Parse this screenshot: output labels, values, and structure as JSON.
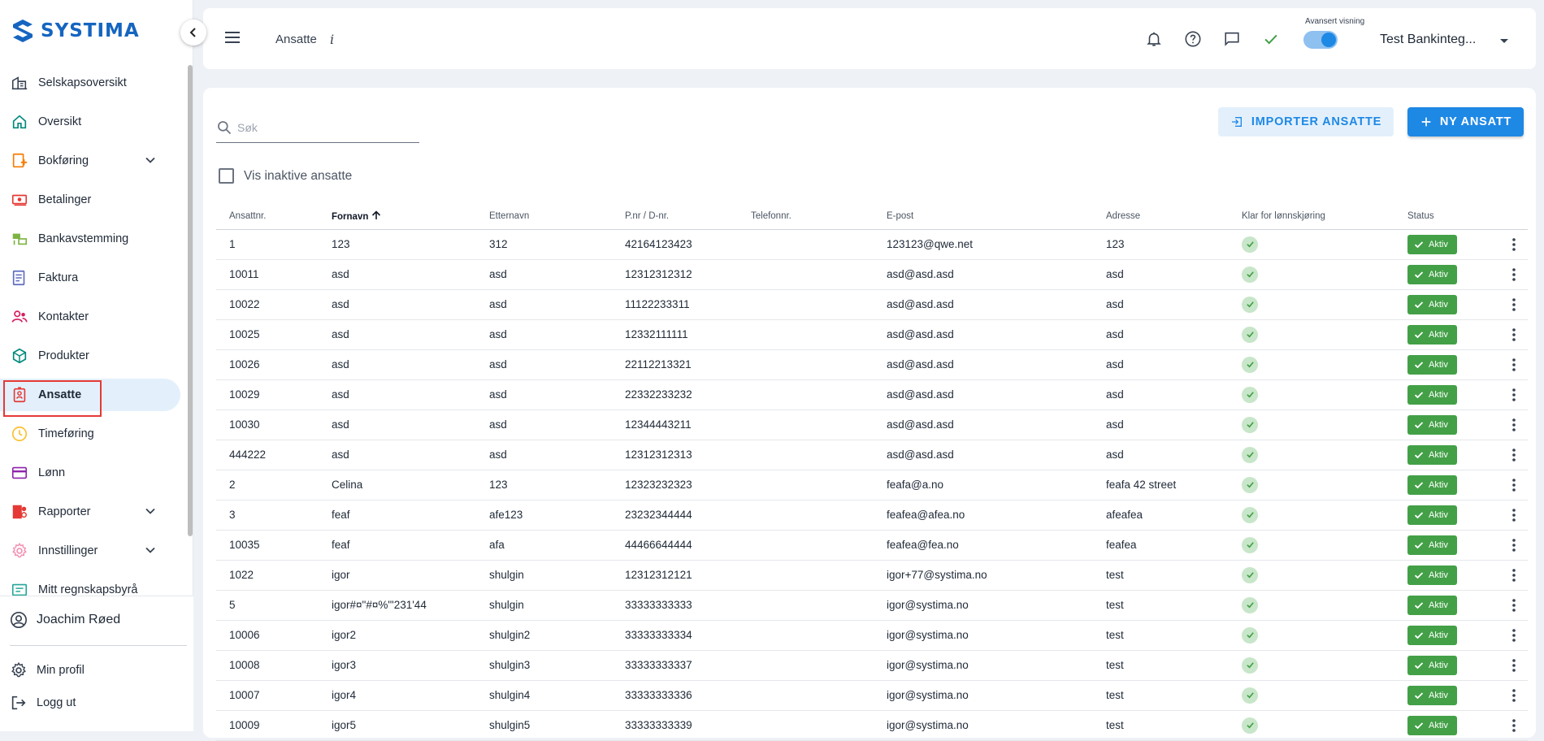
{
  "brand": {
    "name": "SYSTIMA",
    "color": "#1565c0"
  },
  "sidebar": {
    "items": [
      {
        "label": "Selskapsoversikt",
        "icon": "company-overview-icon",
        "color": "#374151"
      },
      {
        "label": "Oversikt",
        "icon": "home-icon",
        "color": "#00897b"
      },
      {
        "label": "Bokføring",
        "icon": "bookkeeping-icon",
        "color": "#f57c00",
        "expandable": true
      },
      {
        "label": "Betalinger",
        "icon": "payments-icon",
        "color": "#e53935"
      },
      {
        "label": "Bankavstemming",
        "icon": "bank-reconciliation-icon",
        "color": "#7cb342"
      },
      {
        "label": "Faktura",
        "icon": "invoice-icon",
        "color": "#5c6bc0"
      },
      {
        "label": "Kontakter",
        "icon": "contacts-icon",
        "color": "#d81b60"
      },
      {
        "label": "Produkter",
        "icon": "products-icon",
        "color": "#00897b"
      },
      {
        "label": "Ansatte",
        "icon": "employees-icon",
        "color": "#e53935",
        "active": true
      },
      {
        "label": "Timeføring",
        "icon": "clock-icon",
        "color": "#fbc02d"
      },
      {
        "label": "Lønn",
        "icon": "salary-icon",
        "color": "#8e24aa"
      },
      {
        "label": "Rapporter",
        "icon": "reports-icon",
        "color": "#e53935",
        "expandable": true
      },
      {
        "label": "Innstillinger",
        "icon": "settings-icon",
        "color": "#f48fb1",
        "expandable": true
      },
      {
        "label": "Mitt regnskapsbyrå",
        "icon": "accounting-firm-icon",
        "color": "#26a69a"
      }
    ],
    "user_name": "Joachim Røed",
    "profile_label": "Min profil",
    "logout_label": "Logg ut"
  },
  "topbar": {
    "title": "Ansatte",
    "info": "i",
    "advanced_view_label": "Avansert visning",
    "advanced_view_on": true,
    "company": "Test Bankinteg..."
  },
  "toolbar": {
    "search_placeholder": "Søk",
    "import_label": "IMPORTER ANSATTE",
    "new_label": "NY ANSATT",
    "inactive_label": "Vis inaktive ansatte"
  },
  "table": {
    "headers": [
      "Ansattnr.",
      "Fornavn",
      "Etternavn",
      "P.nr / D-nr.",
      "Telefonnr.",
      "E-post",
      "Adresse",
      "Klar for lønnskjøring",
      "Status"
    ],
    "sort_column": "Fornavn",
    "status_label": "Aktiv",
    "rows": [
      [
        "1",
        "123",
        "312",
        "42164123423",
        "",
        "123123@qwe.net",
        "123"
      ],
      [
        "10011",
        "asd",
        "asd",
        "12312312312",
        "",
        "asd@asd.asd",
        "asd"
      ],
      [
        "10022",
        "asd",
        "asd",
        "11122233311",
        "",
        "asd@asd.asd",
        "asd"
      ],
      [
        "10025",
        "asd",
        "asd",
        "12332111111",
        "",
        "asd@asd.asd",
        "asd"
      ],
      [
        "10026",
        "asd",
        "asd",
        "22112213321",
        "",
        "asd@asd.asd",
        "asd"
      ],
      [
        "10029",
        "asd",
        "asd",
        "22332233232",
        "",
        "asd@asd.asd",
        "asd"
      ],
      [
        "10030",
        "asd",
        "asd",
        "12344443211",
        "",
        "asd@asd.asd",
        "asd"
      ],
      [
        "444222",
        "asd",
        "asd",
        "12312312313",
        "",
        "asd@asd.asd",
        "asd"
      ],
      [
        "2",
        "Celina",
        "123",
        "12323232323",
        "",
        "feafa@a.no",
        "feafa 42 street"
      ],
      [
        "3",
        "feaf",
        "afe123",
        "23232344444",
        "",
        "feafea@afea.no",
        "afeafea"
      ],
      [
        "10035",
        "feaf",
        "afa",
        "44466644444",
        "",
        "feafea@fea.no",
        "feafea"
      ],
      [
        "1022",
        "igor",
        "shulgin",
        "12312312121",
        "",
        "igor+77@systima.no",
        "test"
      ],
      [
        "5",
        "igor#¤\"#¤%\"'231'44",
        "shulgin",
        "33333333333",
        "",
        "igor@systima.no",
        "test"
      ],
      [
        "10006",
        "igor2",
        "shulgin2",
        "33333333334",
        "",
        "igor@systima.no",
        "test"
      ],
      [
        "10008",
        "igor3",
        "shulgin3",
        "33333333337",
        "",
        "igor@systima.no",
        "test"
      ],
      [
        "10007",
        "igor4",
        "shulgin4",
        "33333333336",
        "",
        "igor@systima.no",
        "test"
      ],
      [
        "10009",
        "igor5",
        "shulgin5",
        "33333333339",
        "",
        "igor@systima.no",
        "test"
      ]
    ]
  },
  "colors": {
    "accent": "#1e88e5",
    "status_active": "#43a047",
    "ok_bg": "#c8e6c9",
    "highlight": "#e53935"
  }
}
